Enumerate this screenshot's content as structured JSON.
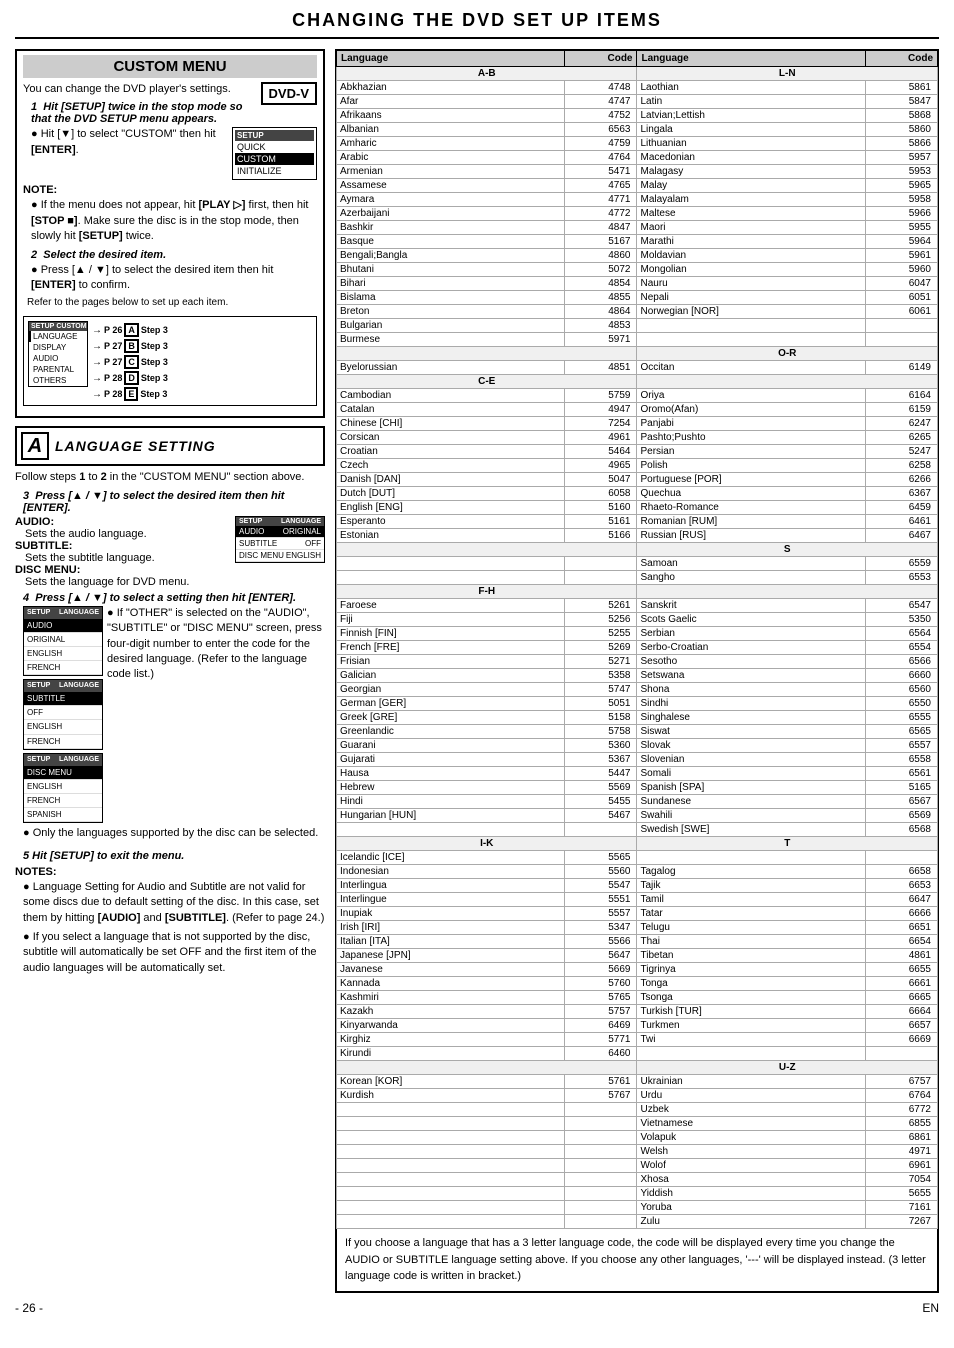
{
  "page": {
    "title": "CHANGING THE DVD SET UP ITEMS",
    "footer_page": "- 26 -",
    "footer_lang": "EN"
  },
  "left": {
    "custom_menu_title": "CUSTOM MENU",
    "dvd_badge": "DVD-V",
    "intro_text": "You can change the DVD player's settings.",
    "step1": {
      "number": "1",
      "text": "Hit [SETUP] twice in the stop mode so that the DVD SETUP menu appears."
    },
    "bullet1": "Hit [▼] to select \"CUSTOM\" then hit [ENTER].",
    "menu_items": [
      "QUICK",
      "CUSTOM",
      "INITIALIZE"
    ],
    "note_header": "NOTE:",
    "note1": "If the menu does not appear, hit [PLAY ▷] first, then hit [STOP ■]. Make sure the disc is in the stop mode, then slowly hit [SETUP] twice.",
    "step2": {
      "number": "2",
      "text": "Select the desired item."
    },
    "bullet2": "Press [▲ / ▼] to select the desired item then hit [ENTER] to confirm.",
    "nav_items": [
      "LANGUAGE",
      "DISPLAY",
      "AUDIO",
      "PARENTAL",
      "OTHERS"
    ],
    "nav_arrows": [
      {
        "page": "P 26",
        "letter": "A",
        "step": "Step 3"
      },
      {
        "page": "P 27",
        "letter": "B",
        "step": "Step 3"
      },
      {
        "page": "P 27",
        "letter": "C",
        "step": "Step 3"
      },
      {
        "page": "P 28",
        "letter": "D",
        "step": "Step 3"
      },
      {
        "page": "P 28",
        "letter": "E",
        "step": "Step 3"
      }
    ],
    "section_a_letter": "A",
    "section_a_title": "LANGUAGE SETTING",
    "follow_text": "Follow steps 1 to 2 in the \"CUSTOM MENU\" section above.",
    "step3": {
      "number": "3",
      "text": "Press [▲ / ▼] to select the desired item then hit [ENTER]."
    },
    "audio_label": "AUDIO:",
    "audio_desc": "Sets the audio language.",
    "subtitle_label": "SUBTITLE:",
    "subtitle_desc": "Sets the subtitle language.",
    "disc_menu_label": "DISC MENU:",
    "disc_menu_desc": "Sets the language for DVD menu.",
    "lang_setup1": {
      "audio": "ORIGINAL",
      "subtitle": "OFF",
      "disc_menu": "ENGLISH"
    },
    "step4": {
      "number": "4",
      "text": "Press [▲ / ▼] to select a setting then hit [ENTER]."
    },
    "bullet4a": "If \"OTHER\" is selected on the \"AUDIO\", \"SUBTITLE\" or \"DISC MENU\" screen, press four-digit number to enter the code for the desired language. (Refer to the language code list.)",
    "bullet4b": "Only the languages supported by the disc can be selected.",
    "setup_screens": [
      {
        "label": "AUDIO",
        "items": [
          "ORIGINAL",
          "ENGLISH",
          "FRENCH"
        ]
      },
      {
        "label": "SUBTITLE",
        "items": [
          "OFF",
          "ENGLISH",
          "FRENCH"
        ]
      },
      {
        "label": "DISC MENU",
        "items": [
          "ENGLISH",
          "FRENCH",
          "SPANISH"
        ]
      }
    ],
    "step5_text": "5  Hit [SETUP] to exit the menu.",
    "notes_header": "NOTES:",
    "bottom_note1": "Language Setting for Audio and Subtitle are not valid for some discs due to default setting of the disc. In this case, set them by hitting [AUDIO] and [SUBTITLE]. (Refer to page 24.)",
    "bottom_note2": "If you select a language that is not supported by the disc, subtitle will automatically be set OFF and the first item of the audio languages will be automatically set."
  },
  "table": {
    "col1_header": "Language",
    "col2_header": "Code",
    "col3_header": "Language",
    "col4_header": "Code",
    "sections": [
      {
        "header": "A-B",
        "header2": "L-N",
        "entries": [
          {
            "lang1": "Abkhazian",
            "code1": "4748",
            "lang2": "Laothian",
            "code2": "5861"
          },
          {
            "lang1": "Afar",
            "code1": "4747",
            "lang2": "Latin",
            "code2": "5847"
          },
          {
            "lang1": "Afrikaans",
            "code1": "4752",
            "lang2": "Latvian;Lettish",
            "code2": "5868"
          },
          {
            "lang1": "Albanian",
            "code1": "6563",
            "lang2": "Lingala",
            "code2": "5860"
          },
          {
            "lang1": "Amharic",
            "code1": "4759",
            "lang2": "Lithuanian",
            "code2": "5866"
          },
          {
            "lang1": "Arabic",
            "code1": "4764",
            "lang2": "Macedonian",
            "code2": "5957"
          },
          {
            "lang1": "Armenian",
            "code1": "5471",
            "lang2": "Malagasy",
            "code2": "5953"
          },
          {
            "lang1": "Assamese",
            "code1": "4765",
            "lang2": "Malay",
            "code2": "5965"
          },
          {
            "lang1": "Aymara",
            "code1": "4771",
            "lang2": "Malayalam",
            "code2": "5958"
          },
          {
            "lang1": "Azerbaijani",
            "code1": "4772",
            "lang2": "Maltese",
            "code2": "5966"
          },
          {
            "lang1": "Bashkir",
            "code1": "4847",
            "lang2": "Maori",
            "code2": "5955"
          },
          {
            "lang1": "Basque",
            "code1": "5167",
            "lang2": "Marathi",
            "code2": "5964"
          },
          {
            "lang1": "Bengali;Bangla",
            "code1": "4860",
            "lang2": "Moldavian",
            "code2": "5961"
          },
          {
            "lang1": "Bhutani",
            "code1": "5072",
            "lang2": "Mongolian",
            "code2": "5960"
          },
          {
            "lang1": "Bihari",
            "code1": "4854",
            "lang2": "Nauru",
            "code2": "6047"
          },
          {
            "lang1": "Bislama",
            "code1": "4855",
            "lang2": "Nepali",
            "code2": "6051"
          },
          {
            "lang1": "Breton",
            "code1": "4864",
            "lang2": "Norwegian [NOR]",
            "code2": "6061"
          },
          {
            "lang1": "Bulgarian",
            "code1": "4853",
            "lang2": "",
            "code2": ""
          }
        ]
      },
      {
        "header": "",
        "header_mid": "O-R",
        "entries_mid": [
          {
            "lang1": "Burmese",
            "code1": "5971",
            "lang2": "Occitan",
            "code2": "6149"
          },
          {
            "lang1": "Byelorussian",
            "code1": "4851",
            "lang2": "Oriya",
            "code2": "6164"
          }
        ]
      },
      {
        "header": "C-E",
        "entries": [
          {
            "lang1": "Cambodian",
            "code1": "5759",
            "lang2": "Oromo(Afan)",
            "code2": "6159"
          },
          {
            "lang1": "Catalan",
            "code1": "4947",
            "lang2": "Panjabi",
            "code2": "6247"
          },
          {
            "lang1": "Chinese [CHI]",
            "code1": "7254",
            "lang2": "Pashto;Pushto",
            "code2": "6265"
          },
          {
            "lang1": "Corsican",
            "code1": "4961",
            "lang2": "Persian",
            "code2": "5247"
          },
          {
            "lang1": "Croatian",
            "code1": "5464",
            "lang2": "Polish",
            "code2": "6258"
          },
          {
            "lang1": "Czech",
            "code1": "4965",
            "lang2": "Portuguese [POR]",
            "code2": "6266"
          },
          {
            "lang1": "Danish [DAN]",
            "code1": "5047",
            "lang2": "Quechua",
            "code2": "6367"
          },
          {
            "lang1": "Dutch [DUT]",
            "code1": "6058",
            "lang2": "Rhaeto-Romance",
            "code2": "6459"
          },
          {
            "lang1": "English [ENG]",
            "code1": "5160",
            "lang2": "Romanian [RUM]",
            "code2": "6461"
          },
          {
            "lang1": "Esperanto",
            "code1": "5161",
            "lang2": "Russian [RUS]",
            "code2": "6467"
          },
          {
            "lang1": "Estonian",
            "code1": "5166",
            "lang2": "",
            "code2": ""
          }
        ]
      },
      {
        "header": "S",
        "entries_s": [
          {
            "lang1": "",
            "code1": "",
            "lang2": "Samoan",
            "code2": "6559"
          },
          {
            "lang1": "",
            "code1": "",
            "lang2": "Sangho",
            "code2": "6553"
          }
        ]
      },
      {
        "header": "F-H",
        "entries": [
          {
            "lang1": "Faroese",
            "code1": "5261",
            "lang2": "Sanskrit",
            "code2": "6547"
          },
          {
            "lang1": "Fiji",
            "code1": "5256",
            "lang2": "Scots Gaelic",
            "code2": "5350"
          },
          {
            "lang1": "Finnish [FIN]",
            "code1": "5255",
            "lang2": "Serbian",
            "code2": "6564"
          },
          {
            "lang1": "French [FRE]",
            "code1": "5269",
            "lang2": "Serbo-Croatian",
            "code2": "6554"
          },
          {
            "lang1": "Frisian",
            "code1": "5271",
            "lang2": "Sesotho",
            "code2": "6566"
          },
          {
            "lang1": "Galician",
            "code1": "5358",
            "lang2": "Setswana",
            "code2": "6660"
          },
          {
            "lang1": "Georgian",
            "code1": "5747",
            "lang2": "Shona",
            "code2": "6560"
          },
          {
            "lang1": "German [GER]",
            "code1": "5051",
            "lang2": "Sindhi",
            "code2": "6550"
          },
          {
            "lang1": "Greek [GRE]",
            "code1": "5158",
            "lang2": "Singhalese",
            "code2": "6555"
          },
          {
            "lang1": "Greenlandic",
            "code1": "5758",
            "lang2": "Siswat",
            "code2": "6565"
          },
          {
            "lang1": "Guarani",
            "code1": "5360",
            "lang2": "Slovak",
            "code2": "6557"
          },
          {
            "lang1": "Gujarati",
            "code1": "5367",
            "lang2": "Slovenian",
            "code2": "6558"
          },
          {
            "lang1": "Hausa",
            "code1": "5447",
            "lang2": "Somali",
            "code2": "6561"
          },
          {
            "lang1": "Hebrew",
            "code1": "5569",
            "lang2": "Spanish [SPA]",
            "code2": "5165"
          },
          {
            "lang1": "Hindi",
            "code1": "5455",
            "lang2": "Sundanese",
            "code2": "6567"
          },
          {
            "lang1": "Hungarian [HUN]",
            "code1": "5467",
            "lang2": "Swahili",
            "code2": "6569"
          }
        ]
      },
      {
        "header": "Swedish_row",
        "entries_sw": [
          {
            "lang1": "",
            "code1": "",
            "lang2": "Swedish [SWE]",
            "code2": "6568"
          }
        ]
      },
      {
        "header": "I-K",
        "entries": [
          {
            "lang1": "Icelandic [ICE]",
            "code1": "5565",
            "lang2": "",
            "code2": ""
          },
          {
            "lang1": "Indonesian",
            "code1": "5560",
            "lang2": "Tagalog",
            "code2": "6658"
          },
          {
            "lang1": "Interlingua",
            "code1": "5547",
            "lang2": "Tajik",
            "code2": "6653"
          },
          {
            "lang1": "Interlingue",
            "code1": "5551",
            "lang2": "Tamil",
            "code2": "6647"
          },
          {
            "lang1": "Inupiak",
            "code1": "5557",
            "lang2": "Tatar",
            "code2": "6666"
          },
          {
            "lang1": "Irish [IRI]",
            "code1": "5347",
            "lang2": "Telugu",
            "code2": "6651"
          },
          {
            "lang1": "Italian [ITA]",
            "code1": "5566",
            "lang2": "Thai",
            "code2": "6654"
          },
          {
            "lang1": "Japanese [JPN]",
            "code1": "5647",
            "lang2": "Tibetan",
            "code2": "4861"
          },
          {
            "lang1": "Javanese",
            "code1": "5669",
            "lang2": "Tigrinya",
            "code2": "6655"
          },
          {
            "lang1": "Kannada",
            "code1": "5760",
            "lang2": "Tonga",
            "code2": "6661"
          },
          {
            "lang1": "Kashmiri",
            "code1": "5765",
            "lang2": "Tsonga",
            "code2": "6665"
          },
          {
            "lang1": "Kazakh",
            "code1": "5757",
            "lang2": "Turkish [TUR]",
            "code2": "6664"
          },
          {
            "lang1": "Kinyarwanda",
            "code1": "6469",
            "lang2": "Turkmen",
            "code2": "6657"
          },
          {
            "lang1": "Kirghiz",
            "code1": "5771",
            "lang2": "Twi",
            "code2": "6669"
          },
          {
            "lang1": "Kirundi",
            "code1": "6460",
            "lang2": "",
            "code2": ""
          }
        ]
      },
      {
        "header": "U-Z",
        "entries_uz": [
          {
            "lang1": "Korean [KOR]",
            "code1": "5761",
            "lang2": "Ukrainian",
            "code2": "6757"
          },
          {
            "lang1": "Kurdish",
            "code1": "5767",
            "lang2": "Urdu",
            "code2": "6764"
          },
          {
            "lang1": "",
            "code1": "",
            "lang2": "Uzbek",
            "code2": "6772"
          },
          {
            "lang1": "",
            "code1": "",
            "lang2": "Vietnamese",
            "code2": "6855"
          },
          {
            "lang1": "",
            "code1": "",
            "lang2": "Volapuk",
            "code2": "6861"
          },
          {
            "lang1": "",
            "code1": "",
            "lang2": "Welsh",
            "code2": "4971"
          },
          {
            "lang1": "",
            "code1": "",
            "lang2": "Wolof",
            "code2": "6961"
          },
          {
            "lang1": "",
            "code1": "",
            "lang2": "Xhosa",
            "code2": "7054"
          },
          {
            "lang1": "",
            "code1": "",
            "lang2": "Yiddish",
            "code2": "5655"
          },
          {
            "lang1": "",
            "code1": "",
            "lang2": "Yoruba",
            "code2": "7161"
          },
          {
            "lang1": "",
            "code1": "",
            "lang2": "Zulu",
            "code2": "7267"
          }
        ]
      }
    ],
    "bottom_note": "If you choose a language that has a 3 letter language code, the code will be displayed every time you change the AUDIO or SUBTITLE language setting above. If you choose any other languages, '---' will be displayed instead. (3 letter language code is written in bracket.)"
  }
}
